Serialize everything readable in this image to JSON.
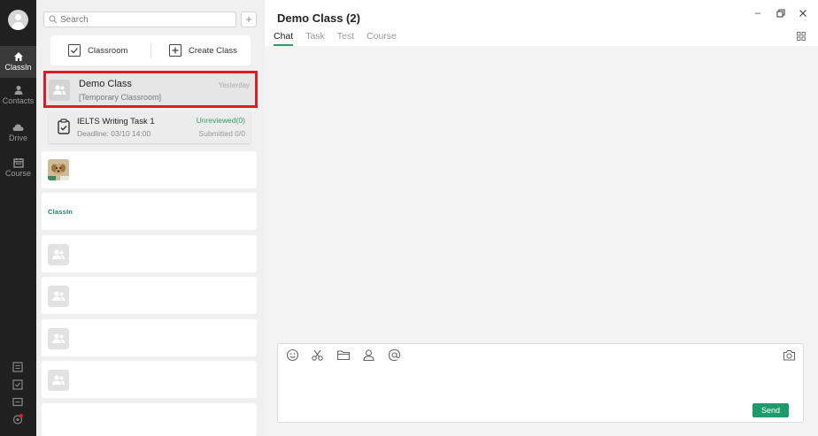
{
  "nav": {
    "items": [
      {
        "label": "ClassIn",
        "icon": "home-icon",
        "active": true
      },
      {
        "label": "Contacts",
        "icon": "contacts-icon",
        "active": false
      },
      {
        "label": "Drive",
        "icon": "cloud-icon",
        "active": false
      },
      {
        "label": "Course",
        "icon": "calendar-icon",
        "active": false
      }
    ]
  },
  "search": {
    "placeholder": "Search"
  },
  "actions": {
    "classroom": "Classroom",
    "create_class": "Create Class"
  },
  "demo_class": {
    "title": "Demo Class",
    "subtitle": "[Temporary Classroom]",
    "time": "Yesterday"
  },
  "task": {
    "title": "IELTS Writing Task 1",
    "deadline": "Deadline: 03/10 14:00",
    "status": "Unreviewed(0)",
    "submitted": "Submitted 0/0"
  },
  "brand_item": {
    "label": "ClassIn"
  },
  "header": {
    "title": "Demo Class (2)"
  },
  "tabs": [
    {
      "label": "Chat",
      "active": true
    },
    {
      "label": "Task",
      "active": false
    },
    {
      "label": "Test",
      "active": false
    },
    {
      "label": "Course",
      "active": false
    }
  ],
  "composer": {
    "send_label": "Send"
  },
  "colors": {
    "accent": "#1e9b6a",
    "highlight": "#e01b24",
    "rail": "#202020"
  }
}
